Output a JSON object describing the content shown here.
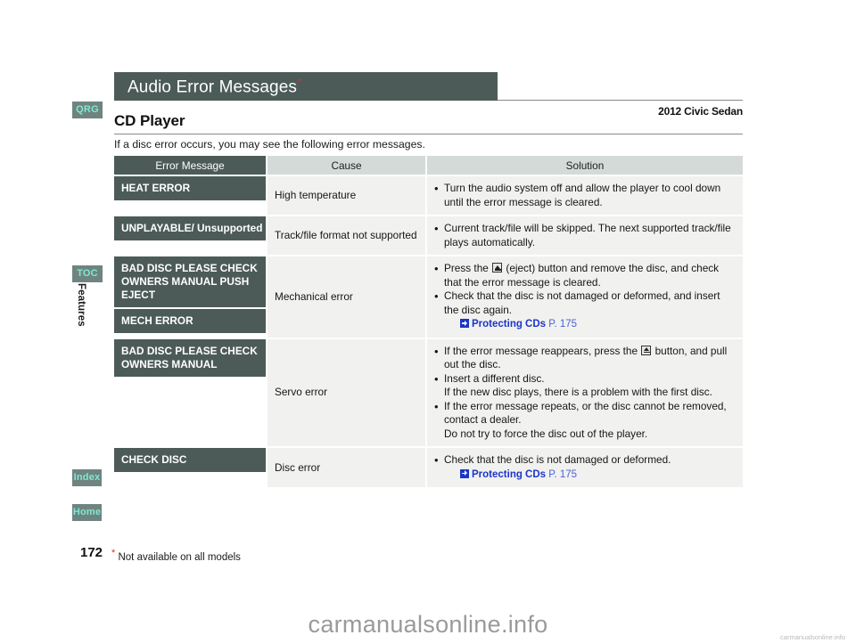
{
  "sidebar": {
    "buttons": [
      {
        "id": "qrg",
        "label": "QRG"
      },
      {
        "id": "toc",
        "label": "TOC"
      },
      {
        "id": "index",
        "label": "Index"
      },
      {
        "id": "home",
        "label": "Home"
      }
    ],
    "section_tab": "Features"
  },
  "header": {
    "banner_title": "Audio Error Messages",
    "banner_asterisk": "*",
    "model": "2012 Civic Sedan"
  },
  "content": {
    "section_title": "CD Player",
    "intro": "If a disc error occurs, you may see the following error messages."
  },
  "table": {
    "columns": [
      "Error Message",
      "Cause",
      "Solution"
    ],
    "rows": [
      {
        "errors": [
          "HEAT ERROR"
        ],
        "cause": "High temperature",
        "bullets": [
          {
            "text": "Turn the audio system off and allow the player to cool down until the error message is cleared."
          }
        ]
      },
      {
        "errors": [
          "UNPLAYABLE/ Unsupported"
        ],
        "cause": "Track/file format not supported",
        "bullets": [
          {
            "text": "Current track/file will be skipped. The next supported track/file plays automatically."
          }
        ]
      },
      {
        "errors": [
          "BAD DISC  PLEASE CHECK OWNERS MANUAL  PUSH EJECT",
          "MECH ERROR"
        ],
        "cause": "Mechanical error",
        "bullets": [
          {
            "text_before": "Press the ",
            "icon": "eject-icon",
            "text_after": " (eject) button and remove the disc, and check that the error message is cleared."
          },
          {
            "text": "Check that the disc is not damaged or deformed, and insert the disc again.",
            "xref": {
              "icon": "jump-link-icon",
              "label": "Protecting CDs",
              "page": "P. 175"
            }
          }
        ]
      },
      {
        "errors": [
          "BAD DISC  PLEASE CHECK OWNERS MANUAL"
        ],
        "cause": "Servo error",
        "bullets": [
          {
            "text_before": "If the error message reappears, press the ",
            "icon": "eject-icon",
            "text_after": " button, and pull out the disc."
          },
          {
            "text": "Insert a different disc.",
            "text2": "If the new disc plays, there is a problem with the first disc."
          },
          {
            "text": "If the error message repeats, or the disc cannot be removed, contact a dealer.",
            "text2": "Do not try to force the disc out of the player."
          }
        ]
      },
      {
        "errors": [
          "CHECK DISC"
        ],
        "cause": "Disc error",
        "bullets": [
          {
            "text": "Check that the disc is not damaged or deformed.",
            "xref": {
              "icon": "jump-link-icon",
              "label": "Protecting CDs",
              "page": "P. 175"
            }
          }
        ]
      }
    ]
  },
  "footer": {
    "page_number": "172",
    "footnote_asterisk": "*",
    "footnote": " Not available on all models"
  },
  "watermark": {
    "main": "carmanualsonline.info",
    "small": "carmanualsonline.info"
  },
  "colors": {
    "dark": "#4c5b58",
    "header_gray": "#d4dad8",
    "cell_gray": "#f1f1f0",
    "nav_bg": "#6f8480",
    "nav_text": "#7fe8d0",
    "link": "#1b35c8",
    "asterisk": "#e8262d"
  }
}
